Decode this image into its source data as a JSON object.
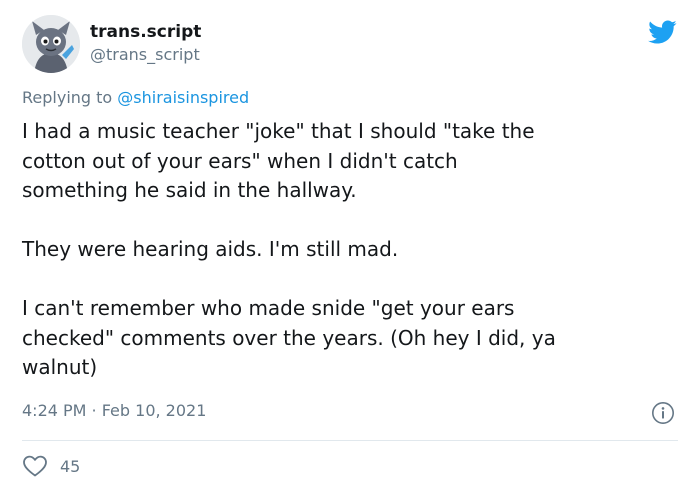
{
  "author": {
    "display_name": "trans.script",
    "handle": "@trans_script",
    "avatar_icon": "cartoon-character-avatar"
  },
  "brand": {
    "icon": "twitter-bird-icon",
    "color": "#1da1f2"
  },
  "reply_context": {
    "prefix": "Replying to",
    "mention": "@shiraisinspired"
  },
  "tweet": {
    "lines": [
      "I had a music teacher \"joke\" that I should \"take the",
      "cotton out of your ears\" when I didn't catch",
      "something he said in the hallway.",
      "They were hearing aids. I'm still mad.",
      "I can't remember who made snide \"get your ears",
      "checked\" comments over the years. (Oh hey I did, ya",
      "walnut)"
    ],
    "timestamp": "4:24 PM · Feb 10, 2021"
  },
  "stats": {
    "likes": "45"
  },
  "colors": {
    "text": "#14171a",
    "secondary": "#657786",
    "link": "#1b95e0",
    "divider": "#e1e8ed"
  }
}
